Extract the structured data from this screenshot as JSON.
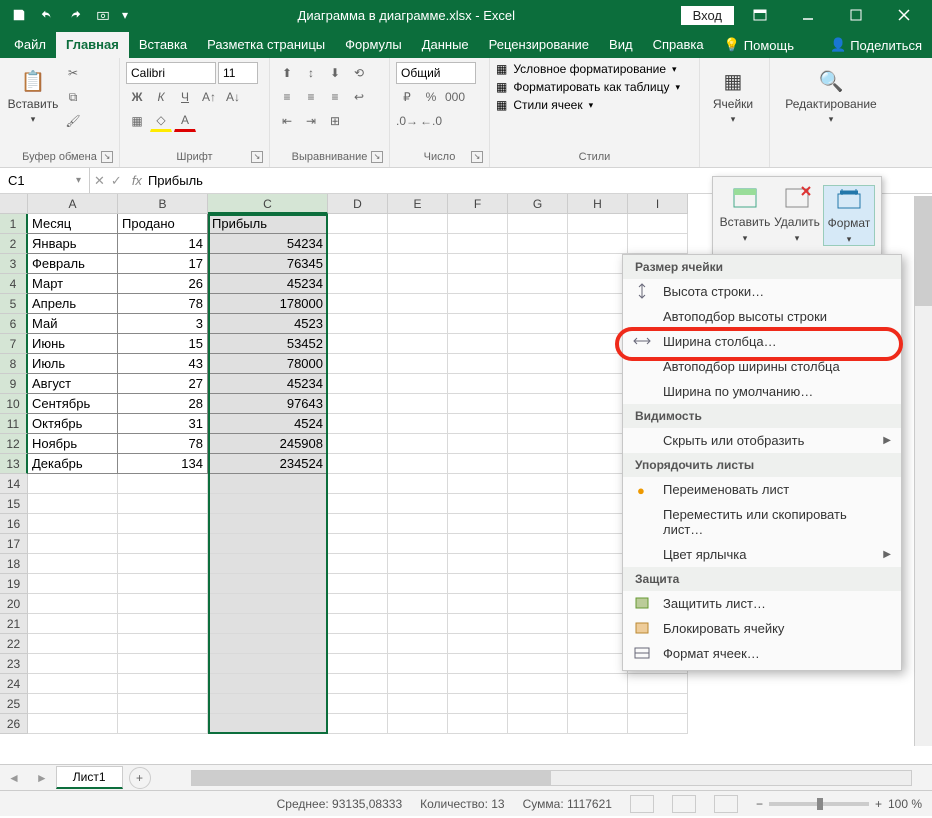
{
  "titlebar": {
    "title": "Диаграмма в диаграмме.xlsx - Excel",
    "login": "Вход"
  },
  "tabs": {
    "file": "Файл",
    "home": "Главная",
    "insert": "Вставка",
    "layout": "Разметка страницы",
    "formulas": "Формулы",
    "data": "Данные",
    "review": "Рецензирование",
    "view": "Вид",
    "help": "Справка",
    "tellme": "Помощь",
    "share": "Поделиться"
  },
  "ribbon": {
    "clipboard": {
      "paste": "Вставить",
      "label": "Буфер обмена"
    },
    "font": {
      "name": "Calibri",
      "size": "11",
      "label": "Шрифт"
    },
    "align": {
      "label": "Выравнивание"
    },
    "number": {
      "format": "Общий",
      "label": "Число"
    },
    "styles": {
      "cond": "Условное форматирование",
      "table": "Форматировать как таблицу",
      "cell": "Стили ячеек",
      "label": "Стили"
    },
    "cells": {
      "label": "Ячейки"
    },
    "editing": {
      "label": "Редактирование"
    }
  },
  "cells_popup": {
    "insert": "Вставить",
    "delete": "Удалить",
    "format": "Формат"
  },
  "format_menu": {
    "size_hdr": "Размер ячейки",
    "row_height": "Высота строки…",
    "autofit_row": "Автоподбор высоты строки",
    "col_width": "Ширина столбца…",
    "autofit_col": "Автоподбор ширины столбца",
    "default_width": "Ширина по умолчанию…",
    "visibility_hdr": "Видимость",
    "hide": "Скрыть или отобразить",
    "sheets_hdr": "Упорядочить листы",
    "rename": "Переименовать лист",
    "move": "Переместить или скопировать лист…",
    "tab_color": "Цвет ярлычка",
    "protect_hdr": "Защита",
    "protect_sheet": "Защитить лист…",
    "lock_cell": "Блокировать ячейку",
    "format_cells": "Формат ячеек…"
  },
  "namebox": "C1",
  "formula": "Прибыль",
  "columns": [
    "A",
    "B",
    "C",
    "D",
    "E",
    "F",
    "G",
    "H",
    "I"
  ],
  "headers": {
    "a": "Месяц",
    "b": "Продано",
    "c": "Прибыль"
  },
  "rows": [
    {
      "a": "Январь",
      "b": "14",
      "c": "54234"
    },
    {
      "a": "Февраль",
      "b": "17",
      "c": "76345"
    },
    {
      "a": "Март",
      "b": "26",
      "c": "45234"
    },
    {
      "a": "Апрель",
      "b": "78",
      "c": "178000"
    },
    {
      "a": "Май",
      "b": "3",
      "c": "4523"
    },
    {
      "a": "Июнь",
      "b": "15",
      "c": "53452"
    },
    {
      "a": "Июль",
      "b": "43",
      "c": "78000"
    },
    {
      "a": "Август",
      "b": "27",
      "c": "45234"
    },
    {
      "a": "Сентябрь",
      "b": "28",
      "c": "97643"
    },
    {
      "a": "Октябрь",
      "b": "31",
      "c": "4524"
    },
    {
      "a": "Ноябрь",
      "b": "78",
      "c": "245908"
    },
    {
      "a": "Декабрь",
      "b": "134",
      "c": "234524"
    }
  ],
  "sheet": "Лист1",
  "status": {
    "avg_label": "Среднее:",
    "avg": "93135,08333",
    "count_label": "Количество:",
    "count": "13",
    "sum_label": "Сумма:",
    "sum": "1117621",
    "zoom": "100 %"
  }
}
